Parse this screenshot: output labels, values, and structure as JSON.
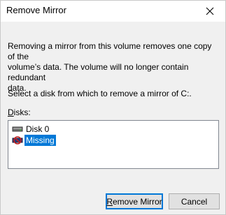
{
  "window": {
    "title": "Remove Mirror",
    "close_icon": "close-icon"
  },
  "description": "Removing a mirror from this volume removes one copy of the\nvolume’s data. The volume will no longer contain redundant\ndata.",
  "prompt": "Select a disk from which to remove a mirror of C:.",
  "disks": {
    "label_accel": "D",
    "label_rest": "isks:",
    "items": [
      {
        "label": "Disk 0",
        "icon": "disk-icon",
        "selected": false
      },
      {
        "label": "Missing",
        "icon": "missing-disk-icon",
        "selected": true
      }
    ]
  },
  "buttons": {
    "remove_accel": "R",
    "remove_rest": "emove Mirror",
    "cancel": "Cancel"
  },
  "colors": {
    "selection": "#0078d7",
    "focus_border": "#0078d7"
  }
}
